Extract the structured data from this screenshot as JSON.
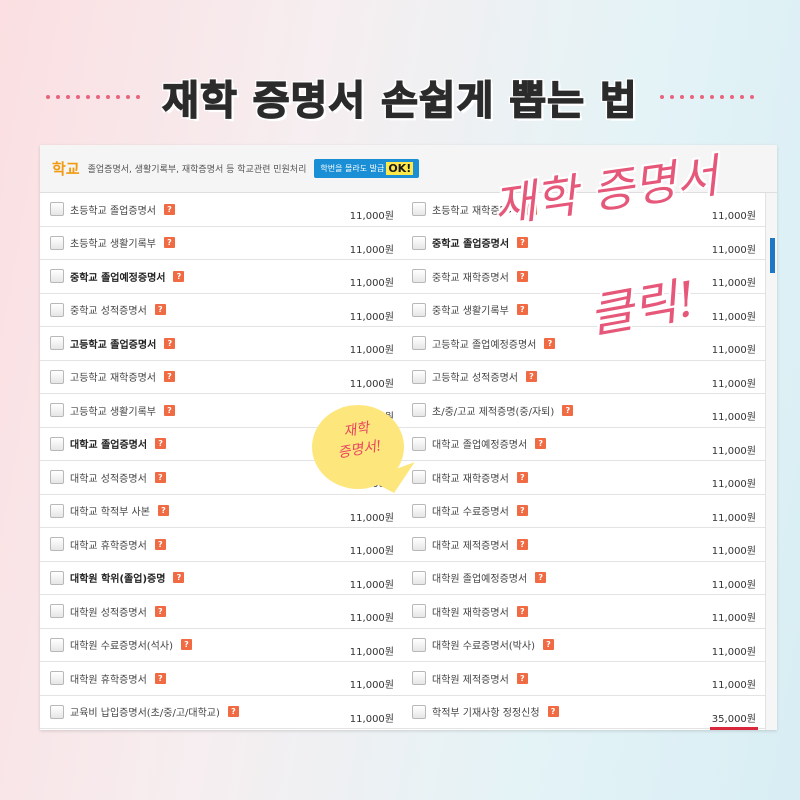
{
  "headline": "재학 증명서 손쉽게 뽑는 법",
  "panel": {
    "title": "학교",
    "description": "졸업증명서, 생활기록부, 재학증명서 등 학교관련 민원처리",
    "badge_text": "학번을 몰라도 발급",
    "badge_ok": "OK!"
  },
  "help_glyph": "?",
  "rows": [
    [
      {
        "label": "초등학교 졸업증명서",
        "bold": false,
        "price": "11,000원"
      },
      {
        "label": "초등학교 재학증명서",
        "bold": false,
        "price": "11,000원"
      }
    ],
    [
      {
        "label": "초등학교 생활기록부",
        "bold": false,
        "price": "11,000원"
      },
      {
        "label": "중학교 졸업증명서",
        "bold": true,
        "price": "11,000원"
      }
    ],
    [
      {
        "label": "중학교 졸업예정증명서",
        "bold": true,
        "price": "11,000원"
      },
      {
        "label": "중학교 재학증명서",
        "bold": false,
        "price": "11,000원"
      }
    ],
    [
      {
        "label": "중학교 성적증명서",
        "bold": false,
        "price": "11,000원"
      },
      {
        "label": "중학교 생활기록부",
        "bold": false,
        "price": "11,000원"
      }
    ],
    [
      {
        "label": "고등학교 졸업증명서",
        "bold": true,
        "price": "11,000원"
      },
      {
        "label": "고등학교 졸업예정증명서",
        "bold": false,
        "price": "11,000원"
      }
    ],
    [
      {
        "label": "고등학교 재학증명서",
        "bold": false,
        "price": "11,000원"
      },
      {
        "label": "고등학교 성적증명서",
        "bold": false,
        "price": "11,000원"
      }
    ],
    [
      {
        "label": "고등학교 생활기록부",
        "bold": false,
        "price": "11,000원"
      },
      {
        "label": "초/중/고교 제적증명(중/자퇴)",
        "bold": false,
        "price": "11,000원"
      }
    ],
    [
      {
        "label": "대학교 졸업증명서",
        "bold": true,
        "price": "11,000원"
      },
      {
        "label": "대학교 졸업예정증명서",
        "bold": false,
        "price": "11,000원"
      }
    ],
    [
      {
        "label": "대학교 성적증명서",
        "bold": false,
        "price": "11,000원"
      },
      {
        "label": "대학교 재학증명서",
        "bold": false,
        "price": "11,000원"
      }
    ],
    [
      {
        "label": "대학교 학적부 사본",
        "bold": false,
        "price": "11,000원"
      },
      {
        "label": "대학교 수료증명서",
        "bold": false,
        "price": "11,000원"
      }
    ],
    [
      {
        "label": "대학교 휴학증명서",
        "bold": false,
        "price": "11,000원"
      },
      {
        "label": "대학교 제적증명서",
        "bold": false,
        "price": "11,000원"
      }
    ],
    [
      {
        "label": "대학원 학위(졸업)증명",
        "bold": true,
        "price": "11,000원"
      },
      {
        "label": "대학원 졸업예정증명서",
        "bold": false,
        "price": "11,000원"
      }
    ],
    [
      {
        "label": "대학원 성적증명서",
        "bold": false,
        "price": "11,000원"
      },
      {
        "label": "대학원 재학증명서",
        "bold": false,
        "price": "11,000원"
      }
    ],
    [
      {
        "label": "대학원 수료증명서(석사)",
        "bold": false,
        "price": "11,000원"
      },
      {
        "label": "대학원 수료증명서(박사)",
        "bold": false,
        "price": "11,000원"
      }
    ],
    [
      {
        "label": "대학원 휴학증명서",
        "bold": false,
        "price": "11,000원"
      },
      {
        "label": "대학원 제적증명서",
        "bold": false,
        "price": "11,000원"
      }
    ],
    [
      {
        "label": "교육비 납입증명서(초/중/고/대학교)",
        "bold": false,
        "price": "11,000원"
      },
      {
        "label": "학적부 기재사항 정정신청",
        "bold": false,
        "price": "35,000원"
      }
    ]
  ],
  "annotations": {
    "script_1": "재학 증명서",
    "script_2": "클릭!",
    "bubble_line_1": "재학",
    "bubble_line_2": "증명서!"
  },
  "colors": {
    "accent_pink": "#e6587a",
    "title_orange": "#f29a12",
    "help_red": "#f06a43",
    "badge_blue": "#1b8fd6",
    "bubble_yellow": "#fde77d"
  }
}
